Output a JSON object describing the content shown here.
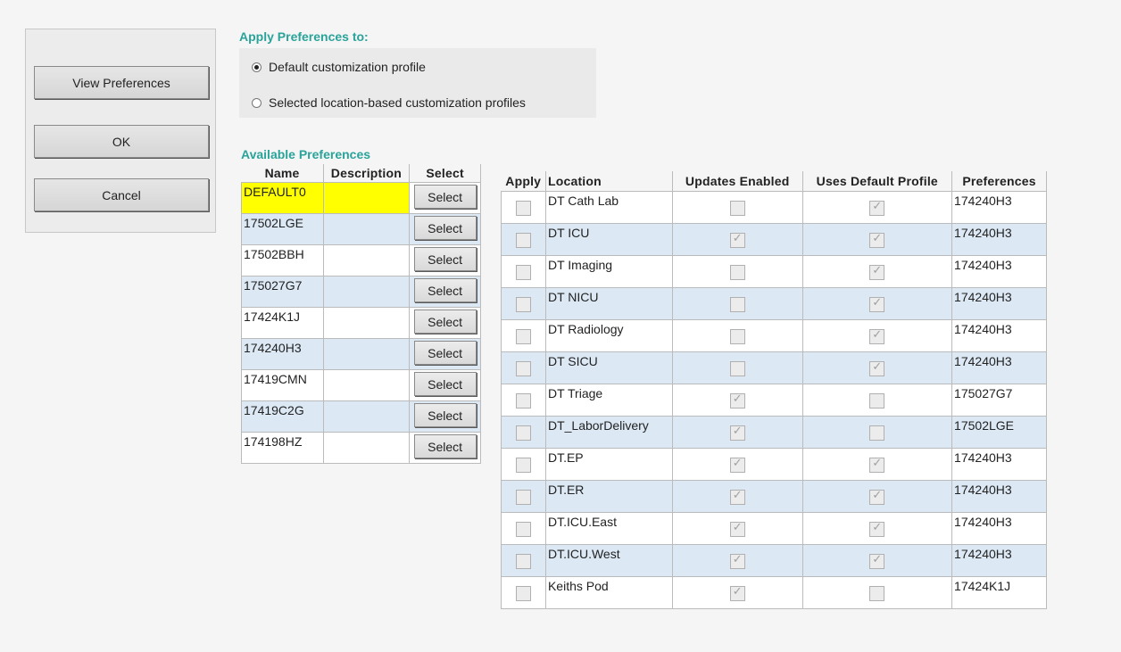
{
  "sidebar": {
    "view_preferences_label": "View Preferences",
    "ok_label": "OK",
    "cancel_label": "Cancel"
  },
  "apply": {
    "title": "Apply Preferences to:",
    "option_default": "Default customization profile",
    "option_selected": "Selected location-based customization profiles",
    "selected_option": "default"
  },
  "available": {
    "title": "Available Preferences",
    "headers": {
      "name": "Name",
      "description": "Description",
      "select": "Select"
    },
    "select_label": "Select",
    "rows": [
      {
        "name": "DEFAULT0",
        "description": ""
      },
      {
        "name": "17502LGE",
        "description": ""
      },
      {
        "name": "17502BBH",
        "description": ""
      },
      {
        "name": "175027G7",
        "description": ""
      },
      {
        "name": "17424K1J",
        "description": ""
      },
      {
        "name": "174240H3",
        "description": ""
      },
      {
        "name": "17419CMN",
        "description": ""
      },
      {
        "name": "17419C2G",
        "description": ""
      },
      {
        "name": "174198HZ",
        "description": ""
      }
    ]
  },
  "locations": {
    "headers": {
      "apply": "Apply",
      "location": "Location",
      "updates_enabled": "Updates Enabled",
      "uses_default": "Uses Default Profile",
      "preferences": "Preferences"
    },
    "rows": [
      {
        "location": "DT Cath Lab",
        "updates": false,
        "uses_default": true,
        "pref": "174240H3"
      },
      {
        "location": "DT ICU",
        "updates": true,
        "uses_default": true,
        "pref": "174240H3"
      },
      {
        "location": "DT Imaging",
        "updates": false,
        "uses_default": true,
        "pref": "174240H3"
      },
      {
        "location": "DT NICU",
        "updates": false,
        "uses_default": true,
        "pref": "174240H3"
      },
      {
        "location": "DT Radiology",
        "updates": false,
        "uses_default": true,
        "pref": "174240H3"
      },
      {
        "location": "DT SICU",
        "updates": false,
        "uses_default": true,
        "pref": "174240H3"
      },
      {
        "location": "DT Triage",
        "updates": true,
        "uses_default": false,
        "pref": "175027G7"
      },
      {
        "location": "DT_LaborDelivery",
        "updates": true,
        "uses_default": false,
        "pref": "17502LGE"
      },
      {
        "location": "DT.EP",
        "updates": true,
        "uses_default": true,
        "pref": "174240H3"
      },
      {
        "location": "DT.ER",
        "updates": true,
        "uses_default": true,
        "pref": "174240H3"
      },
      {
        "location": "DT.ICU.East",
        "updates": true,
        "uses_default": true,
        "pref": "174240H3"
      },
      {
        "location": "DT.ICU.West",
        "updates": true,
        "uses_default": true,
        "pref": "174240H3"
      },
      {
        "location": "Keiths Pod",
        "updates": true,
        "uses_default": false,
        "pref": "17424K1J"
      }
    ]
  }
}
